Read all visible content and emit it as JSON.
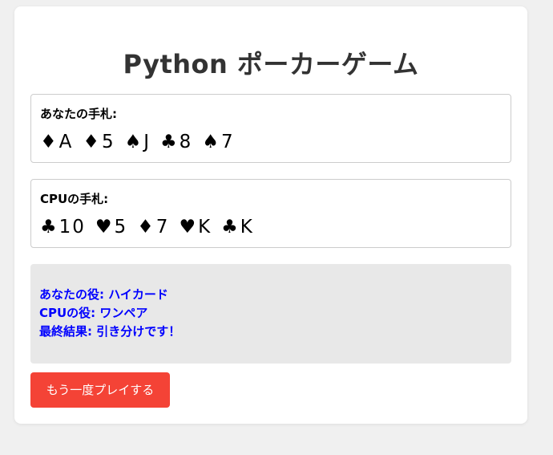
{
  "page": {
    "title": "Python ポーカーゲーム"
  },
  "player_hand": {
    "label": "あなたの手札:",
    "cards": [
      {
        "suit": "♦",
        "rank": "A"
      },
      {
        "suit": "♦",
        "rank": "5"
      },
      {
        "suit": "♠",
        "rank": "J"
      },
      {
        "suit": "♣",
        "rank": "8"
      },
      {
        "suit": "♠",
        "rank": "7"
      }
    ]
  },
  "cpu_hand": {
    "label": "CPUの手札:",
    "cards": [
      {
        "suit": "♣",
        "rank": "10"
      },
      {
        "suit": "♥",
        "rank": "5"
      },
      {
        "suit": "♦",
        "rank": "7"
      },
      {
        "suit": "♥",
        "rank": "K"
      },
      {
        "suit": "♣",
        "rank": "K"
      }
    ]
  },
  "result": {
    "player_role": "あなたの役: ハイカード",
    "cpu_role": "CPUの役: ワンペア",
    "final": "最終結果: 引き分けです！"
  },
  "actions": {
    "replay_label": "もう一度プレイする"
  },
  "colors": {
    "background": "#f0f0f0",
    "card_background": "#ffffff",
    "result_background": "#e8e8e8",
    "result_text": "#0000ff",
    "button_background": "#f44336",
    "button_text": "#ffffff"
  }
}
